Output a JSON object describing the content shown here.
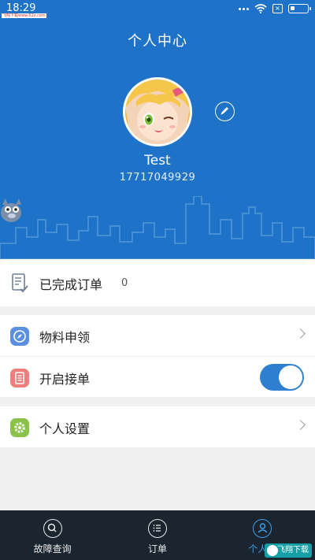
{
  "status_bar": {
    "time": "18:29",
    "watermark": "飞翔下载www.52z.com"
  },
  "header": {
    "title": "个人中心"
  },
  "profile": {
    "name": "Test",
    "phone": "17717049929"
  },
  "completed_orders": {
    "label": "已完成订单",
    "count": "0"
  },
  "menu": {
    "material_request": {
      "label": "物料申领"
    },
    "accept_orders": {
      "label": "开启接单",
      "enabled": true
    }
  },
  "settings": {
    "label": "个人设置"
  },
  "bottom_nav": {
    "items": [
      {
        "label": "故障查询",
        "icon": "search-icon",
        "active": false
      },
      {
        "label": "订单",
        "icon": "list-icon",
        "active": false
      },
      {
        "label": "个人中",
        "icon": "person-icon",
        "active": true
      }
    ]
  },
  "badge": {
    "text": "飞翔下载"
  },
  "colors": {
    "header_blue": "#1e73c8",
    "toggle_blue": "#2f7fd0",
    "active_tab": "#3aa0ea",
    "nav_bg": "#1b2530",
    "icon_material": "#5b8fe0",
    "icon_orders": "#ee7d7d",
    "icon_settings": "#8bc34a"
  }
}
